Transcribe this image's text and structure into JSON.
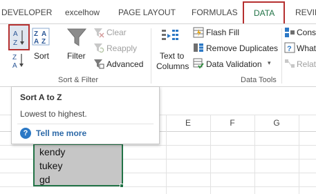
{
  "tabs": {
    "developer": "DEVELOPER",
    "excelhow": "excelhow",
    "page_layout": "PAGE LAYOUT",
    "formulas": "FORMULAS",
    "data": "DATA",
    "review": "REVIEW"
  },
  "ribbon": {
    "sort_label": "Sort",
    "filter_label": "Filter",
    "clear_label": "Clear",
    "reapply_label": "Reapply",
    "advanced_label": "Advanced",
    "sort_filter_group": "Sort & Filter",
    "text_to_columns_line1": "Text to",
    "text_to_columns_line2": "Columns",
    "flash_fill_label": "Flash Fill",
    "remove_duplicates_label": "Remove Duplicates",
    "data_validation_label": "Data Validation",
    "data_tools_group": "Data Tools",
    "consolidate_label": "Conso",
    "whatif_label": "What",
    "relationships_label": "Relati"
  },
  "grid": {
    "columns": [
      "E",
      "F",
      "G"
    ],
    "cells": [
      "kendy",
      "tukey",
      "gd"
    ]
  },
  "tooltip": {
    "title": "Sort A to Z",
    "description": "Lowest to highest.",
    "help_link": "Tell me more"
  },
  "colors": {
    "highlight": "#b52f2f",
    "excel_green": "#217346",
    "link_blue": "#2e6aa8",
    "selection_fill": "#c6c6c6"
  }
}
